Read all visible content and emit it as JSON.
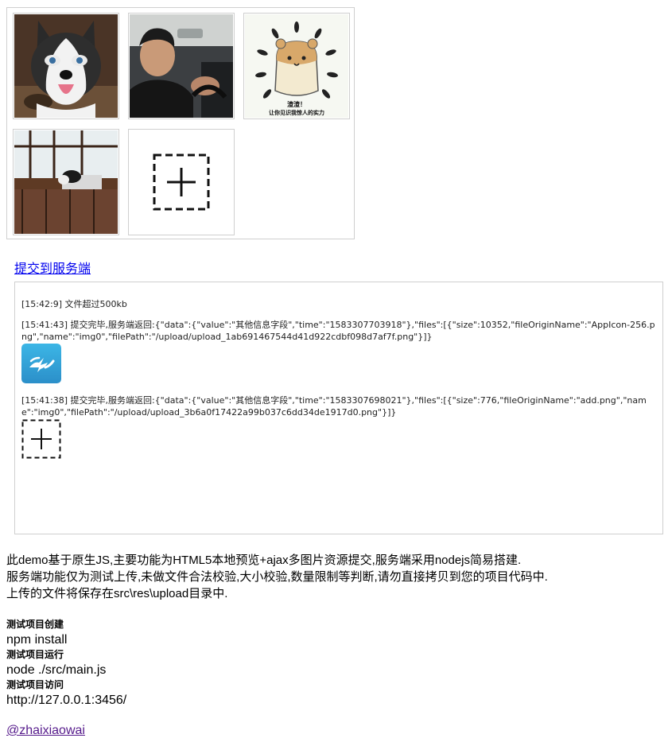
{
  "preview_grid": {
    "images": [
      {
        "name": "husky-dog-photo"
      },
      {
        "name": "man-in-car-photo"
      },
      {
        "name": "hamster-meme-image",
        "caption_line1": "渣渣！",
        "caption_line2": "让你见识我惊人的实力"
      },
      {
        "name": "room-with-dog-photo"
      }
    ],
    "add_button": {
      "icon": "add-plus-icon"
    }
  },
  "submit_link": "提交到服务端",
  "log": {
    "entries": [
      {
        "text": "[15:42:9] 文件超过500kb"
      },
      {
        "text": "[15:41:43] 提交完毕,服务端返回:{\"data\":{\"value\":\"其他信息字段\",\"time\":\"1583307703918\"},\"files\":[{\"size\":10352,\"fileOriginName\":\"AppIcon-256.png\",\"name\":\"img0\",\"filePath\":\"/upload/upload_1ab691467544d41d922cdbf098d7af7f.png\"}]}",
        "image": "app-icon"
      },
      {
        "text": "[15:41:38] 提交完毕,服务端返回:{\"data\":{\"value\":\"其他信息字段\",\"time\":\"1583307698021\"},\"files\":[{\"size\":776,\"fileOriginName\":\"add.png\",\"name\":\"img0\",\"filePath\":\"/upload/upload_3b6a0f17422a99b037c6dd34de1917d0.png\"}]}",
        "image": "add-icon"
      }
    ],
    "colors": {
      "app_icon_top": "#3cb6e6",
      "app_icon_bottom": "#2b8fc9"
    }
  },
  "description": {
    "line1": "此demo基于原生JS,主要功能为HTML5本地预览+ajax多图片资源提交,服务端采用nodejs简易搭建.",
    "line2": "服务端功能仅为测试上传,未做文件合法校验,大小校验,数量限制等判断,请勿直接拷贝到您的项目代码中.",
    "line3": "上传的文件将保存在src\\res\\upload目录中."
  },
  "steps": [
    {
      "heading": "测试项目创建",
      "value": "npm install"
    },
    {
      "heading": "测试项目运行",
      "value": "node ./src/main.js"
    },
    {
      "heading": "测试项目访问",
      "value": "http://127.0.0.1:3456/"
    }
  ],
  "author": "@zhaixiaowai",
  "colors": {
    "link": "#0000ee",
    "visited_link": "#551a8b",
    "border": "#cfcfcf"
  }
}
